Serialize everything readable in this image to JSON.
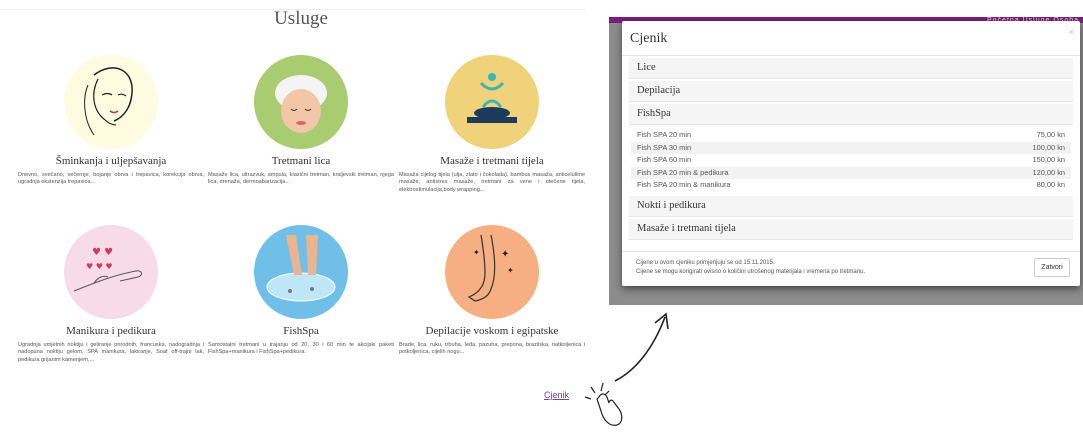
{
  "page": {
    "title": "Usluge",
    "link_label": "Cjenik"
  },
  "services": [
    {
      "title": "Šminkanja i uljepšavanja",
      "desc": "Dnevno, svečano, večernje, bojanje obrva i trepavica, korekcija obrva, ugradnja ekstenzija trepavica...",
      "bg": "#fffbe0"
    },
    {
      "title": "Tretmani lica",
      "desc": "Masaže lica, ultrazvuk, ampula, klasični tretman, kraljevski tretman, njega lica, drenaža, dermoabarizacija...",
      "bg": "#a9cc70"
    },
    {
      "title": "Masaže i tretmani tijela",
      "desc": "Masaža cijelog tijela (ulja, zlato i čokolada), bambus masaža, anticelulitne masaže, antistres masaže, tretmani za vene i otečene tijela, elektrostimulacija,body wrapping...",
      "bg": "#efd27a"
    },
    {
      "title": "Manikura i pedikura",
      "desc": "Ugradnja umjetnih noktiju i geliranje prirodnih, francuska, nadogradnja i nadopuna noktiju gelom, SPA manikura, lakiranje, Soaf off-trajni lak, pedikura grijanim kamenjem,...",
      "bg": "#f7dbe6"
    },
    {
      "title": "FishSpa",
      "desc": "Samostalni tretmani u trajanju od 20, 30 i 60 min te akcijski paketi FishSpa+manikura i FishSpa+pedikura.",
      "bg": "#6fbfe8"
    },
    {
      "title": "Depilacije voskom i egipatske",
      "desc": "Brade, lica, ruku, trbuha, leđa, pazuha, prepona, brazilska, natkoljenica i potkoljenica, cijelih nogu...",
      "bg": "#f6ae83"
    }
  ],
  "modal": {
    "title": "Cjenik",
    "close_symbol": "×",
    "sections_before": [
      "Lice",
      "Depilacija"
    ],
    "open_section": "FishSpa",
    "prices": [
      {
        "name": "Fish SPA 20 min",
        "price": "75,00 kn"
      },
      {
        "name": "Fish SPA 30 min",
        "price": "100,00 kn"
      },
      {
        "name": "Fish SPA 60 min",
        "price": "150,00 kn"
      },
      {
        "name": "Fish SPA 20 min & pedikura",
        "price": "120,00 kn"
      },
      {
        "name": "Fish SPA 20 min & manikura",
        "price": "80,00 kn"
      }
    ],
    "sections_after": [
      "Nokti i pedikura",
      "Masaže i tretmani tijela"
    ],
    "note_line1": "Cijene u ovom cjeniku primjenjuju se od 15.11.2015.",
    "note_line2": "Cijene se mogu korigirati ovisno o količini utrošenog materijala i vremena po tretmanu.",
    "close_button": "Zatvori"
  },
  "background_nav": [
    "Početna",
    "Usluge",
    "Osoba"
  ],
  "colors": {
    "link": "#7b4397",
    "topbar": "#7a1e7d"
  }
}
